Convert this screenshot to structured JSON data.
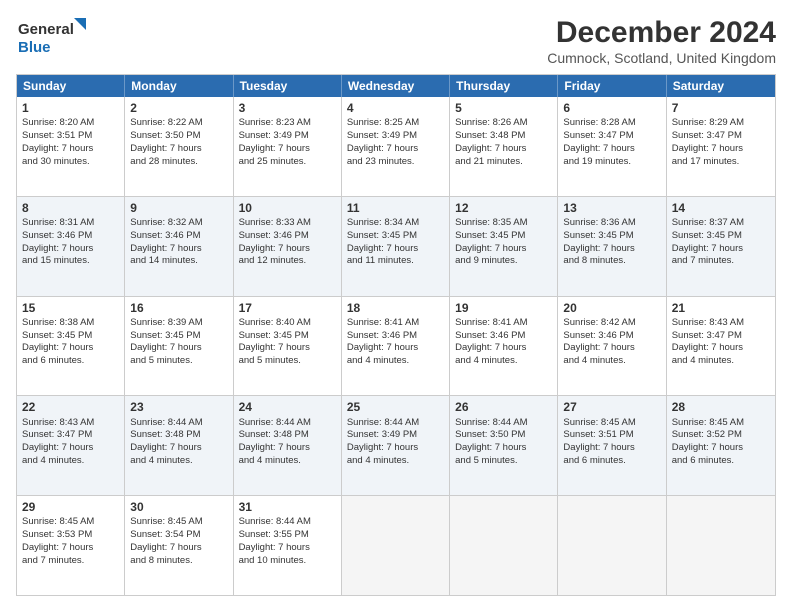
{
  "header": {
    "logo_line1": "General",
    "logo_line2": "Blue",
    "title": "December 2024",
    "subtitle": "Cumnock, Scotland, United Kingdom"
  },
  "days": [
    "Sunday",
    "Monday",
    "Tuesday",
    "Wednesday",
    "Thursday",
    "Friday",
    "Saturday"
  ],
  "rows": [
    [
      {
        "num": "1",
        "lines": [
          "Sunrise: 8:20 AM",
          "Sunset: 3:51 PM",
          "Daylight: 7 hours",
          "and 30 minutes."
        ]
      },
      {
        "num": "2",
        "lines": [
          "Sunrise: 8:22 AM",
          "Sunset: 3:50 PM",
          "Daylight: 7 hours",
          "and 28 minutes."
        ]
      },
      {
        "num": "3",
        "lines": [
          "Sunrise: 8:23 AM",
          "Sunset: 3:49 PM",
          "Daylight: 7 hours",
          "and 25 minutes."
        ]
      },
      {
        "num": "4",
        "lines": [
          "Sunrise: 8:25 AM",
          "Sunset: 3:49 PM",
          "Daylight: 7 hours",
          "and 23 minutes."
        ]
      },
      {
        "num": "5",
        "lines": [
          "Sunrise: 8:26 AM",
          "Sunset: 3:48 PM",
          "Daylight: 7 hours",
          "and 21 minutes."
        ]
      },
      {
        "num": "6",
        "lines": [
          "Sunrise: 8:28 AM",
          "Sunset: 3:47 PM",
          "Daylight: 7 hours",
          "and 19 minutes."
        ]
      },
      {
        "num": "7",
        "lines": [
          "Sunrise: 8:29 AM",
          "Sunset: 3:47 PM",
          "Daylight: 7 hours",
          "and 17 minutes."
        ]
      }
    ],
    [
      {
        "num": "8",
        "lines": [
          "Sunrise: 8:31 AM",
          "Sunset: 3:46 PM",
          "Daylight: 7 hours",
          "and 15 minutes."
        ]
      },
      {
        "num": "9",
        "lines": [
          "Sunrise: 8:32 AM",
          "Sunset: 3:46 PM",
          "Daylight: 7 hours",
          "and 14 minutes."
        ]
      },
      {
        "num": "10",
        "lines": [
          "Sunrise: 8:33 AM",
          "Sunset: 3:46 PM",
          "Daylight: 7 hours",
          "and 12 minutes."
        ]
      },
      {
        "num": "11",
        "lines": [
          "Sunrise: 8:34 AM",
          "Sunset: 3:45 PM",
          "Daylight: 7 hours",
          "and 11 minutes."
        ]
      },
      {
        "num": "12",
        "lines": [
          "Sunrise: 8:35 AM",
          "Sunset: 3:45 PM",
          "Daylight: 7 hours",
          "and 9 minutes."
        ]
      },
      {
        "num": "13",
        "lines": [
          "Sunrise: 8:36 AM",
          "Sunset: 3:45 PM",
          "Daylight: 7 hours",
          "and 8 minutes."
        ]
      },
      {
        "num": "14",
        "lines": [
          "Sunrise: 8:37 AM",
          "Sunset: 3:45 PM",
          "Daylight: 7 hours",
          "and 7 minutes."
        ]
      }
    ],
    [
      {
        "num": "15",
        "lines": [
          "Sunrise: 8:38 AM",
          "Sunset: 3:45 PM",
          "Daylight: 7 hours",
          "and 6 minutes."
        ]
      },
      {
        "num": "16",
        "lines": [
          "Sunrise: 8:39 AM",
          "Sunset: 3:45 PM",
          "Daylight: 7 hours",
          "and 5 minutes."
        ]
      },
      {
        "num": "17",
        "lines": [
          "Sunrise: 8:40 AM",
          "Sunset: 3:45 PM",
          "Daylight: 7 hours",
          "and 5 minutes."
        ]
      },
      {
        "num": "18",
        "lines": [
          "Sunrise: 8:41 AM",
          "Sunset: 3:46 PM",
          "Daylight: 7 hours",
          "and 4 minutes."
        ]
      },
      {
        "num": "19",
        "lines": [
          "Sunrise: 8:41 AM",
          "Sunset: 3:46 PM",
          "Daylight: 7 hours",
          "and 4 minutes."
        ]
      },
      {
        "num": "20",
        "lines": [
          "Sunrise: 8:42 AM",
          "Sunset: 3:46 PM",
          "Daylight: 7 hours",
          "and 4 minutes."
        ]
      },
      {
        "num": "21",
        "lines": [
          "Sunrise: 8:43 AM",
          "Sunset: 3:47 PM",
          "Daylight: 7 hours",
          "and 4 minutes."
        ]
      }
    ],
    [
      {
        "num": "22",
        "lines": [
          "Sunrise: 8:43 AM",
          "Sunset: 3:47 PM",
          "Daylight: 7 hours",
          "and 4 minutes."
        ]
      },
      {
        "num": "23",
        "lines": [
          "Sunrise: 8:44 AM",
          "Sunset: 3:48 PM",
          "Daylight: 7 hours",
          "and 4 minutes."
        ]
      },
      {
        "num": "24",
        "lines": [
          "Sunrise: 8:44 AM",
          "Sunset: 3:48 PM",
          "Daylight: 7 hours",
          "and 4 minutes."
        ]
      },
      {
        "num": "25",
        "lines": [
          "Sunrise: 8:44 AM",
          "Sunset: 3:49 PM",
          "Daylight: 7 hours",
          "and 4 minutes."
        ]
      },
      {
        "num": "26",
        "lines": [
          "Sunrise: 8:44 AM",
          "Sunset: 3:50 PM",
          "Daylight: 7 hours",
          "and 5 minutes."
        ]
      },
      {
        "num": "27",
        "lines": [
          "Sunrise: 8:45 AM",
          "Sunset: 3:51 PM",
          "Daylight: 7 hours",
          "and 6 minutes."
        ]
      },
      {
        "num": "28",
        "lines": [
          "Sunrise: 8:45 AM",
          "Sunset: 3:52 PM",
          "Daylight: 7 hours",
          "and 6 minutes."
        ]
      }
    ],
    [
      {
        "num": "29",
        "lines": [
          "Sunrise: 8:45 AM",
          "Sunset: 3:53 PM",
          "Daylight: 7 hours",
          "and 7 minutes."
        ]
      },
      {
        "num": "30",
        "lines": [
          "Sunrise: 8:45 AM",
          "Sunset: 3:54 PM",
          "Daylight: 7 hours",
          "and 8 minutes."
        ]
      },
      {
        "num": "31",
        "lines": [
          "Sunrise: 8:44 AM",
          "Sunset: 3:55 PM",
          "Daylight: 7 hours",
          "and 10 minutes."
        ]
      },
      {
        "num": "",
        "lines": []
      },
      {
        "num": "",
        "lines": []
      },
      {
        "num": "",
        "lines": []
      },
      {
        "num": "",
        "lines": []
      }
    ]
  ]
}
